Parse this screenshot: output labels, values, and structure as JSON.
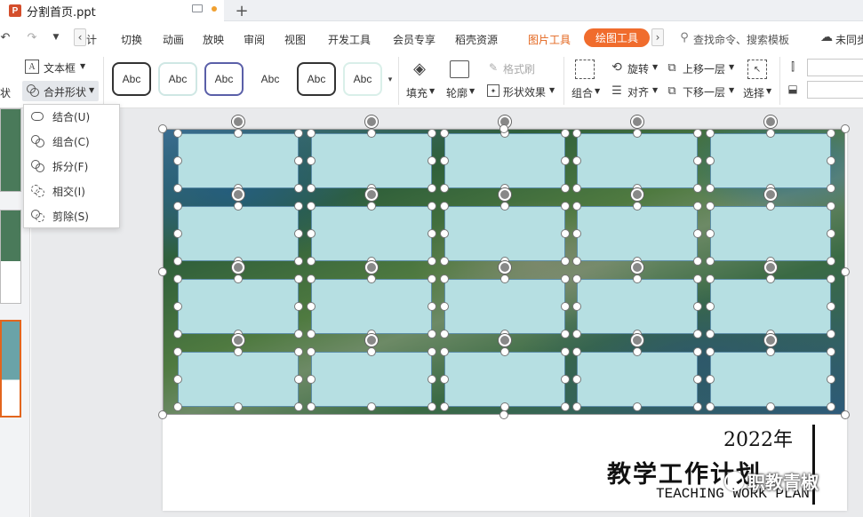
{
  "window": {
    "tab_title": "分割首页.ppt",
    "new_tab": "+"
  },
  "menu": {
    "partial_first": "计",
    "items": [
      "切换",
      "动画",
      "放映",
      "审阅",
      "视图",
      "开发工具",
      "会员专享",
      "稻壳资源"
    ],
    "picture_tools": "图片工具",
    "drawing_tools": "绘图工具",
    "search": "查找命令、搜索模板",
    "sync": "未同步"
  },
  "ribbon": {
    "textbox": "文本框",
    "merge_shape": "合并形状",
    "shape_partial": "状",
    "style_sample": "Abc",
    "fill": "填充",
    "outline": "轮廓",
    "format_painter": "格式刷",
    "shape_effect": "形状效果",
    "rotate": "旋转",
    "align": "对齐",
    "group": "组合",
    "bring_forward": "上移一层",
    "send_backward": "下移一层",
    "select": "选择"
  },
  "merge_menu": {
    "items": [
      {
        "label": "结合(U)"
      },
      {
        "label": "组合(C)"
      },
      {
        "label": "拆分(F)"
      },
      {
        "label": "相交(I)"
      },
      {
        "label": "剪除(S)"
      }
    ]
  },
  "slide": {
    "year": "2022年",
    "title_cn": "教学工作计划",
    "title_en": "TEACHING WORK PLAN",
    "watermark": "职教青椒"
  },
  "colors": {
    "accent": "#f06c2d",
    "shape_fill": "#b6dfe2",
    "shape_border": "#5d8ea8"
  }
}
